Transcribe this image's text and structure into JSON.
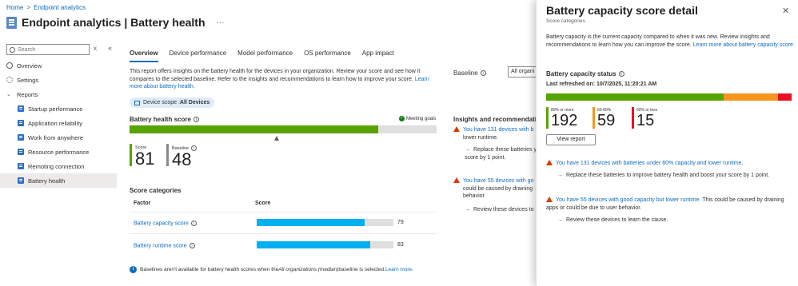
{
  "breadcrumb": [
    "Home",
    "Endpoint analytics"
  ],
  "page": {
    "title": "Endpoint analytics | Battery health",
    "more": "···"
  },
  "sidebar": {
    "search_placeholder": "Search",
    "clear": "x",
    "collapse": "«",
    "items": [
      {
        "label": "Overview",
        "icon": "overview-icon"
      },
      {
        "label": "Settings",
        "icon": "gear-icon"
      },
      {
        "label": "Reports",
        "icon": "chevron-down-icon"
      },
      {
        "label": "Startup performance",
        "icon": "report-icon"
      },
      {
        "label": "Application reliability",
        "icon": "report-icon"
      },
      {
        "label": "Work from anywhere",
        "icon": "report-icon"
      },
      {
        "label": "Resource performance",
        "icon": "report-icon"
      },
      {
        "label": "Remoting connection",
        "icon": "report-icon"
      },
      {
        "label": "Battery health",
        "icon": "report-icon",
        "active": true
      }
    ]
  },
  "tabs": [
    "Overview",
    "Device performance",
    "Model performance",
    "OS performance",
    "App impact"
  ],
  "intro": {
    "text": "This report offers insights on the battery health for the devices in your organization. Review your score and see how it compares to the selected baseline. Refer to the insights and recommendations to learn how to improve your score.",
    "link": "Learn more about battery health."
  },
  "baseline": {
    "label": "Baseline",
    "value": "All organi"
  },
  "scope": {
    "label": "Device scope : ",
    "value": "All Devices"
  },
  "battery_health": {
    "label": "Battery health score",
    "meeting_goals": "Meeting goals",
    "score_label": "Score",
    "score": "81",
    "baseline_label": "Baseline",
    "baseline": "48",
    "score_fraction": 0.81,
    "baseline_fraction": 0.48
  },
  "score_categories": {
    "title": "Score categories",
    "col_factor": "Factor",
    "col_score": "Score",
    "rows": [
      {
        "factor": "Battery capacity score",
        "value": "79",
        "fraction": 0.79
      },
      {
        "factor": "Battery runtime score",
        "value": "83",
        "fraction": 0.83
      }
    ]
  },
  "note": {
    "pre": "Baselines aren't available for battery health scores when the ",
    "italic": "All organizations (median)",
    "post": " baseline is selected. ",
    "link": "Learn more."
  },
  "insights": {
    "title": "Insights and recommendation",
    "items": [
      {
        "link": "You have 131 devices with b",
        "rest": "lower runtime.",
        "sub": "Replace these batteries your score by 1 point."
      },
      {
        "link": "You have 55 devices with go",
        "rest": "could be caused by draining behavior.",
        "sub": "Review these devices to"
      }
    ]
  },
  "panel": {
    "title": "Battery capacity score detail",
    "subtitle": "Score categories",
    "close": "✕",
    "desc": "Battery capacity is the current capacity compared to when it was new. Review insights and recommendations to learn how you can improve the score.",
    "desc_link": "Learn more about battery capacity score",
    "status_label": "Battery capacity status",
    "refreshed": "Last refreshed on: 10/7/2025, 11:20:21 AM",
    "tiers": [
      {
        "label": "80% or more",
        "value": "192",
        "color": "#57a300"
      },
      {
        "label": "60-80%",
        "value": "59",
        "color": "#f7941d"
      },
      {
        "label": "60% or less",
        "value": "15",
        "color": "#e81123"
      }
    ],
    "view_report": "View report",
    "insights": [
      {
        "link": "You have 131 devices with batteries under 60% capacity and lower runtime.",
        "rest": "",
        "sub": "Replace these batteries to improve battery health and boost your score by 1 point."
      },
      {
        "link": "You have 55 devices with good capacity but lower runtime.",
        "rest": " This could be caused by draining apps or could be due to user behavior.",
        "sub": "Review these devices to learn the cause."
      }
    ]
  }
}
